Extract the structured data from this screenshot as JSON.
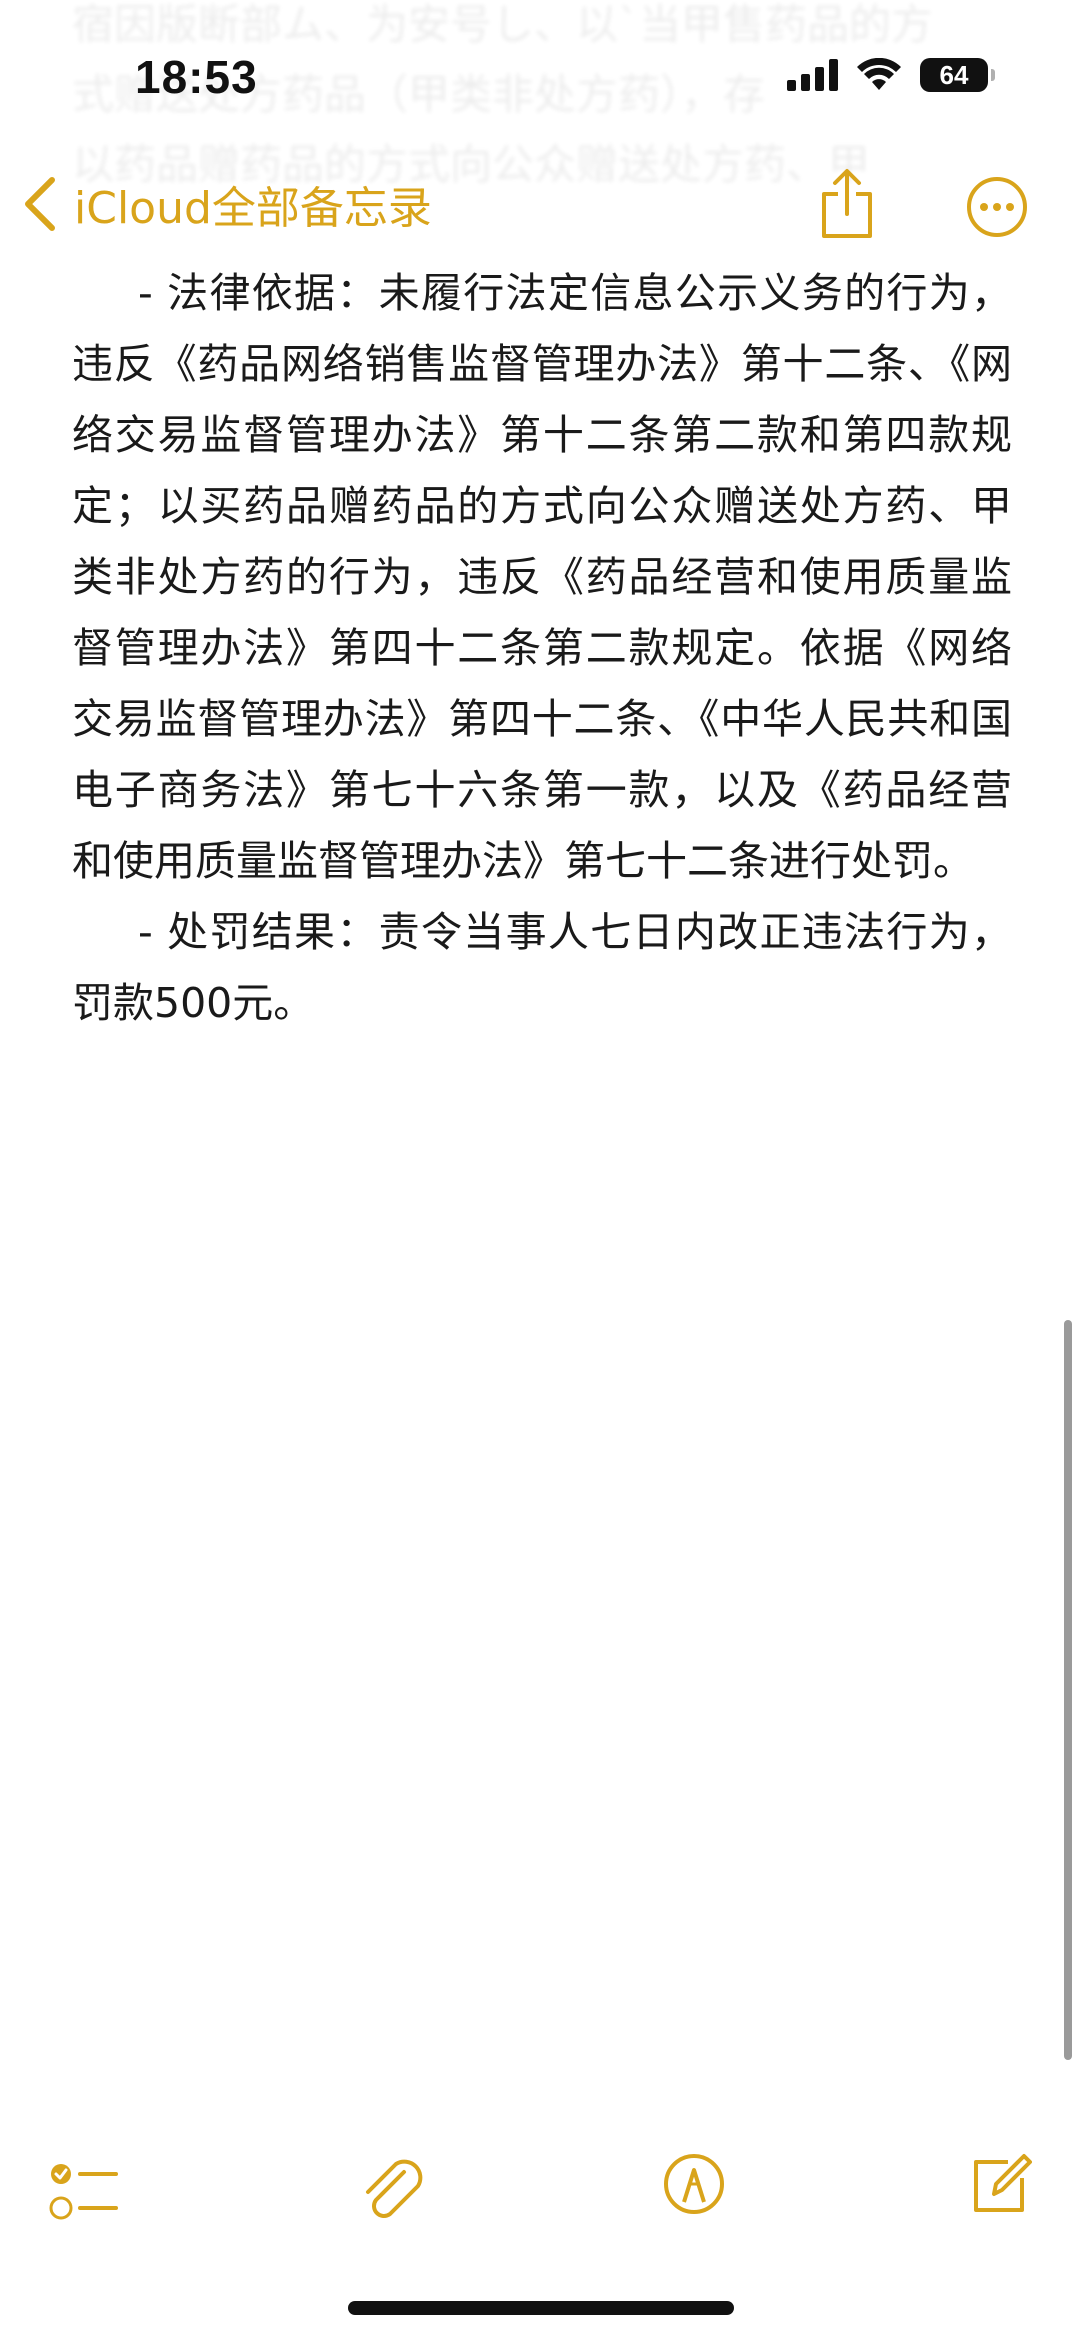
{
  "status_bar": {
    "time": "18:53",
    "battery": "64"
  },
  "nav": {
    "back_label": "iCloud全部备忘录",
    "share_icon": "share-icon",
    "more_icon": "ellipsis-circle-icon"
  },
  "note": {
    "faded_lines": [
      "宿因版断部ム、为安号し、以`当甲售药品的方",
      "式赠送处方药品（甲类非处方药），存",
      "以药品赠药品的方式向公众赠送处方药、甲"
    ],
    "paragraphs": [
      "- 法律依据：未履行法定信息公示义务的行为，违反《药品网络销售监督管理办法》第十二条、《网络交易监督管理办法》第十二条第二款和第四款规定；以买药品赠药品的方式向公众赠送处方药、甲类非处方药的行为，违反《药品经营和使用质量监督管理办法》第四十二条第二款规定。依据《网络交易监督管理办法》第四十二条、《中华人民共和国电子商务法》第七十六条第一款，以及《药品经营和使用质量监督管理办法》第七十二条进行处罚。",
      "- 处罚结果：责令当事人七日内改正违法行为，罚款500元。"
    ]
  },
  "toolbar": {
    "checklist_icon": "checklist-icon",
    "attach_icon": "paperclip-icon",
    "markup_icon": "pen-circle-icon",
    "compose_icon": "compose-icon"
  },
  "colors": {
    "accent": "#d9a41b",
    "text": "#1a1a1a",
    "background": "#ffffff"
  }
}
